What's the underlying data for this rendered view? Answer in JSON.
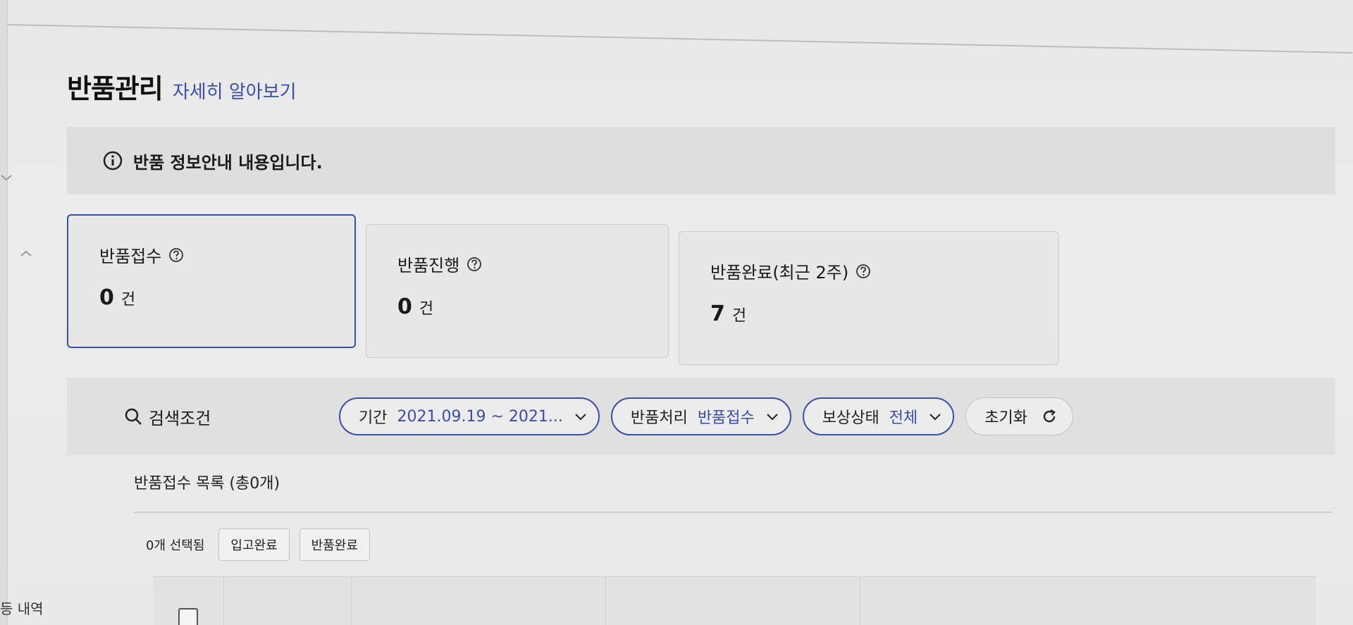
{
  "sidebar": {
    "history_label": "등 내역"
  },
  "header": {
    "title": "반품관리",
    "help_link": "자세히 알아보기"
  },
  "notice": {
    "text": "반품 정보안내 내용입니다."
  },
  "cards": [
    {
      "label": "반품접수",
      "count": "0",
      "unit": "건"
    },
    {
      "label": "반품진행",
      "count": "0",
      "unit": "건"
    },
    {
      "label": "반품완료(최근 2주)",
      "count": "7",
      "unit": "건"
    }
  ],
  "search": {
    "label": "검색조건",
    "filters": [
      {
        "label": "기간",
        "value": "2021.09.19 ~ 2021..."
      },
      {
        "label": "반품처리",
        "value": "반품접수"
      },
      {
        "label": "보상상태",
        "value": "전체"
      }
    ],
    "reset_label": "초기화"
  },
  "list": {
    "title": "반품접수 목록 (총0개)",
    "selected_count": "0개 선택됨",
    "buttons": [
      "입고완료",
      "반품완료"
    ]
  },
  "colors": {
    "accent": "#3b4ea8",
    "link": "#3a4ea8"
  }
}
